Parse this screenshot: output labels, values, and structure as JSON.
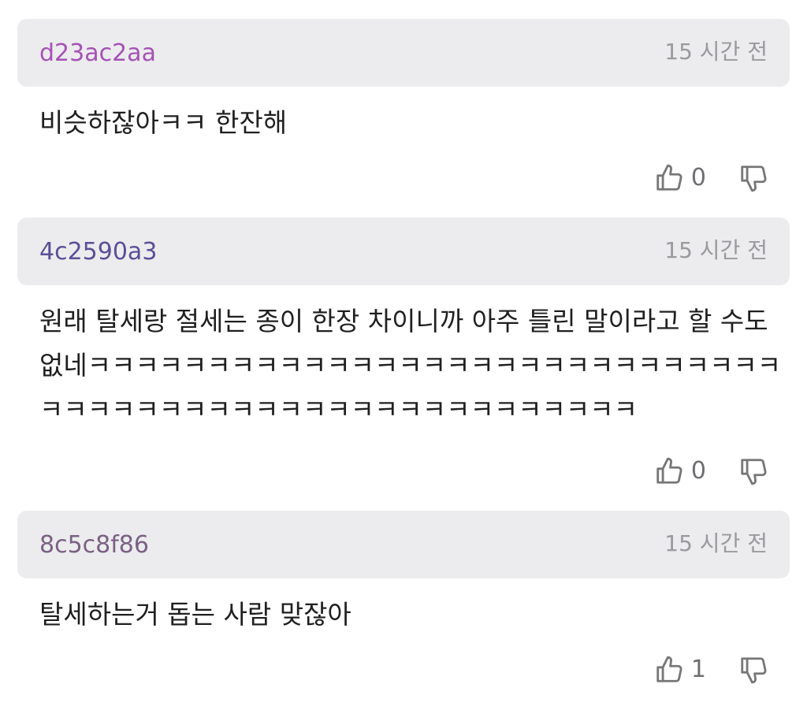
{
  "comments": [
    {
      "author": "d23ac2aa",
      "author_color": "#a552b5",
      "time": "15 시간 전",
      "text": "비슷하잖아ㅋㅋ 한잔해",
      "likes": "0"
    },
    {
      "author": "4c2590a3",
      "author_color": "#5b4f96",
      "time": "15 시간 전",
      "text": "원래 탈세랑 절세는 종이 한장 차이니까 아주 틀린 말이라고 할 수도 없네ㅋㅋㅋㅋㅋㅋㅋㅋㅋㅋㅋㅋㅋㅋㅋㅋㅋㅋㅋㅋㅋㅋㅋㅋㅋㅋㅋㅋㅋㅋㅋㅋㅋㅋㅋㅋㅋㅋㅋㅋㅋㅋㅋㅋㅋㅋㅋㅋㅋㅋㅋㅋㅋㅋ",
      "likes": "0"
    },
    {
      "author": "8c5c8f86",
      "author_color": "#7a6182",
      "time": "15 시간 전",
      "text": "탈세하는거 돕는 사람 맞잖아",
      "likes": "1"
    }
  ],
  "icons": {
    "like": "thumbs-up-icon",
    "dislike": "thumbs-down-icon",
    "icon_color": "#777777"
  }
}
